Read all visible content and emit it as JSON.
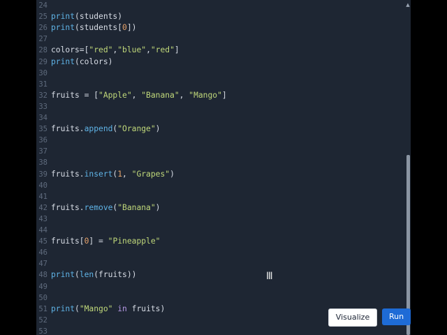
{
  "editor": {
    "lines": [
      {
        "n": "24",
        "code": []
      },
      {
        "n": "25",
        "code": [
          [
            "fn",
            "print"
          ],
          [
            "op",
            "(students)"
          ]
        ]
      },
      {
        "n": "26",
        "code": [
          [
            "fn",
            "print"
          ],
          [
            "op",
            "(students["
          ],
          [
            "num",
            "0"
          ],
          [
            "op",
            "])"
          ]
        ]
      },
      {
        "n": "27",
        "code": []
      },
      {
        "n": "28",
        "code": [
          [
            "op",
            "colors=["
          ],
          [
            "str",
            "\"red\""
          ],
          [
            "op",
            ","
          ],
          [
            "str",
            "\"blue\""
          ],
          [
            "op",
            ","
          ],
          [
            "str",
            "\"red\""
          ],
          [
            "op",
            "]"
          ]
        ]
      },
      {
        "n": "29",
        "code": [
          [
            "fn",
            "print"
          ],
          [
            "op",
            "(colors)"
          ]
        ]
      },
      {
        "n": "30",
        "code": []
      },
      {
        "n": "31",
        "code": []
      },
      {
        "n": "32",
        "code": [
          [
            "op",
            "fruits = ["
          ],
          [
            "str",
            "\"Apple\""
          ],
          [
            "op",
            ", "
          ],
          [
            "str",
            "\"Banana\""
          ],
          [
            "op",
            ", "
          ],
          [
            "str",
            "\"Mango\""
          ],
          [
            "op",
            "]"
          ]
        ]
      },
      {
        "n": "33",
        "code": []
      },
      {
        "n": "34",
        "code": []
      },
      {
        "n": "35",
        "code": [
          [
            "op",
            "fruits."
          ],
          [
            "fn",
            "append"
          ],
          [
            "op",
            "("
          ],
          [
            "str",
            "\"Orange\""
          ],
          [
            "op",
            ")"
          ]
        ]
      },
      {
        "n": "36",
        "code": []
      },
      {
        "n": "37",
        "code": []
      },
      {
        "n": "38",
        "code": []
      },
      {
        "n": "39",
        "code": [
          [
            "op",
            "fruits."
          ],
          [
            "fn",
            "insert"
          ],
          [
            "op",
            "("
          ],
          [
            "num",
            "1"
          ],
          [
            "op",
            ", "
          ],
          [
            "str",
            "\"Grapes\""
          ],
          [
            "op",
            ")"
          ]
        ]
      },
      {
        "n": "40",
        "code": []
      },
      {
        "n": "41",
        "code": []
      },
      {
        "n": "42",
        "code": [
          [
            "op",
            "fruits."
          ],
          [
            "fn",
            "remove"
          ],
          [
            "op",
            "("
          ],
          [
            "str",
            "\"Banana\""
          ],
          [
            "op",
            ")"
          ]
        ]
      },
      {
        "n": "43",
        "code": []
      },
      {
        "n": "44",
        "code": []
      },
      {
        "n": "45",
        "code": [
          [
            "op",
            "fruits["
          ],
          [
            "num",
            "0"
          ],
          [
            "op",
            "] = "
          ],
          [
            "str",
            "\"Pineapple\""
          ]
        ]
      },
      {
        "n": "46",
        "code": []
      },
      {
        "n": "47",
        "code": []
      },
      {
        "n": "48",
        "code": [
          [
            "fn",
            "print"
          ],
          [
            "op",
            "("
          ],
          [
            "fn",
            "len"
          ],
          [
            "op",
            "(fruits))"
          ]
        ]
      },
      {
        "n": "49",
        "code": []
      },
      {
        "n": "50",
        "code": []
      },
      {
        "n": "51",
        "code": [
          [
            "fn",
            "print"
          ],
          [
            "op",
            "("
          ],
          [
            "str",
            "\"Mango\""
          ],
          [
            "op",
            " "
          ],
          [
            "kw",
            "in"
          ],
          [
            "op",
            " fruits)"
          ]
        ]
      },
      {
        "n": "52",
        "code": []
      },
      {
        "n": "53",
        "code": []
      }
    ]
  },
  "buttons": {
    "visualize_label": "Visualize",
    "run_label": "Run"
  },
  "icons": {
    "scroll_up": "scroll-up-arrow-icon",
    "cursor": "text-cursor-icon"
  },
  "colors": {
    "editor_bg": "#1e2633",
    "run_button": "#1e6bd6"
  }
}
